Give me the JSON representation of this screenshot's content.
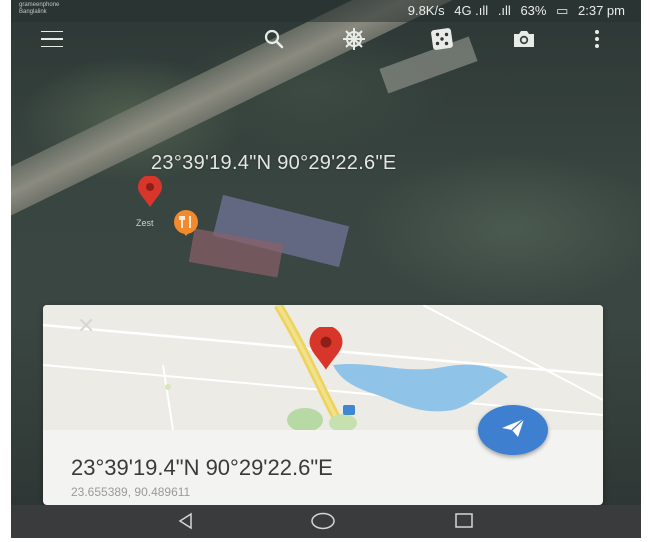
{
  "status_bar": {
    "carrier_line1": "grameenphone",
    "carrier_line2": "Banglalink",
    "net_speed": "9.8K/s",
    "signal_primary": "4G .ıll",
    "signal_secondary": ".ıll",
    "battery": "63%",
    "time": "2:37 pm"
  },
  "toolbar": {
    "icons": [
      "menu-icon",
      "search-icon",
      "ship-wheel-icon",
      "dice-icon",
      "camera-icon",
      "more-vert-icon"
    ]
  },
  "map": {
    "coordinates_overlay": "23°39'19.4\"N 90°29'22.6\"E",
    "place_label": "Zest",
    "marker_colors": {
      "pin": "#d9362b",
      "restaurant": "#f08a2c"
    }
  },
  "sheet": {
    "close_label": "✕",
    "coordinates_dms": "23°39'19.4\"N 90°29'22.6\"E",
    "coordinates_decimal": "23.655389, 90.489611",
    "fab_icon": "directions-icon",
    "fab_color": "#3f7fcf"
  },
  "nav_bar": {
    "icons": [
      "back-icon",
      "home-icon",
      "recents-icon"
    ]
  }
}
